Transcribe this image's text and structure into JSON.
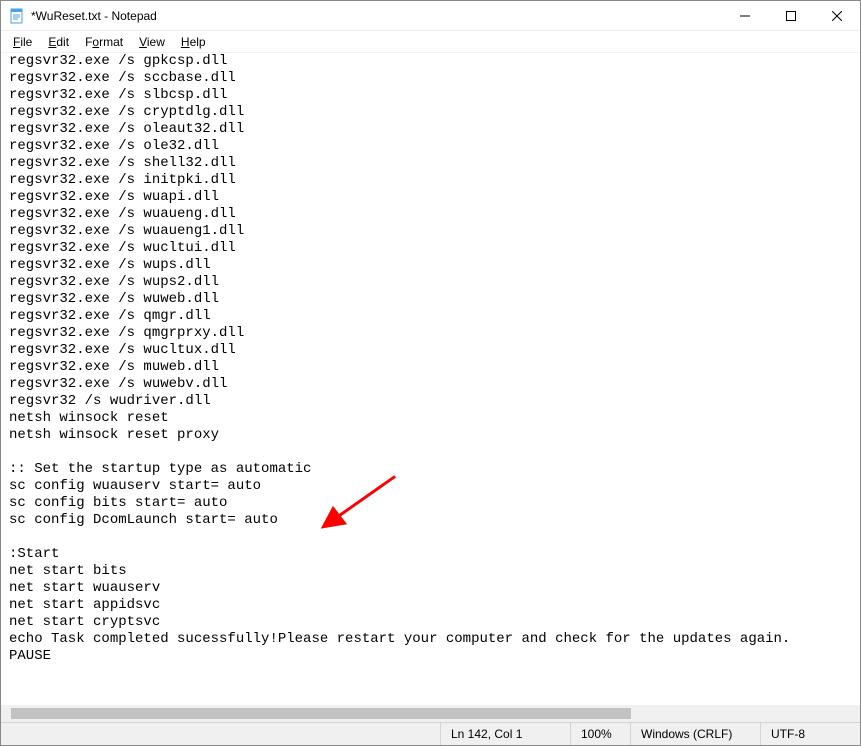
{
  "window": {
    "title": "*WuReset.txt - Notepad"
  },
  "menu": {
    "file": "File",
    "edit": "Edit",
    "format": "Format",
    "view": "View",
    "help": "Help"
  },
  "document": {
    "text": "regsvr32.exe /s gpkcsp.dll\nregsvr32.exe /s sccbase.dll\nregsvr32.exe /s slbcsp.dll\nregsvr32.exe /s cryptdlg.dll\nregsvr32.exe /s oleaut32.dll\nregsvr32.exe /s ole32.dll\nregsvr32.exe /s shell32.dll\nregsvr32.exe /s initpki.dll\nregsvr32.exe /s wuapi.dll\nregsvr32.exe /s wuaueng.dll\nregsvr32.exe /s wuaueng1.dll\nregsvr32.exe /s wucltui.dll\nregsvr32.exe /s wups.dll\nregsvr32.exe /s wups2.dll\nregsvr32.exe /s wuweb.dll\nregsvr32.exe /s qmgr.dll\nregsvr32.exe /s qmgrprxy.dll\nregsvr32.exe /s wucltux.dll\nregsvr32.exe /s muweb.dll\nregsvr32.exe /s wuwebv.dll\nregsvr32 /s wudriver.dll\nnetsh winsock reset\nnetsh winsock reset proxy\n\n:: Set the startup type as automatic\nsc config wuauserv start= auto\nsc config bits start= auto\nsc config DcomLaunch start= auto\n\n:Start\nnet start bits\nnet start wuauserv\nnet start appidsvc\nnet start cryptsvc\necho Task completed sucessfully!Please restart your computer and check for the updates again.\nPAUSE"
  },
  "status": {
    "position": "Ln 142, Col 1",
    "zoom": "100%",
    "eol": "Windows (CRLF)",
    "encoding": "UTF-8"
  },
  "arrow": {
    "color": "#ff0000"
  }
}
